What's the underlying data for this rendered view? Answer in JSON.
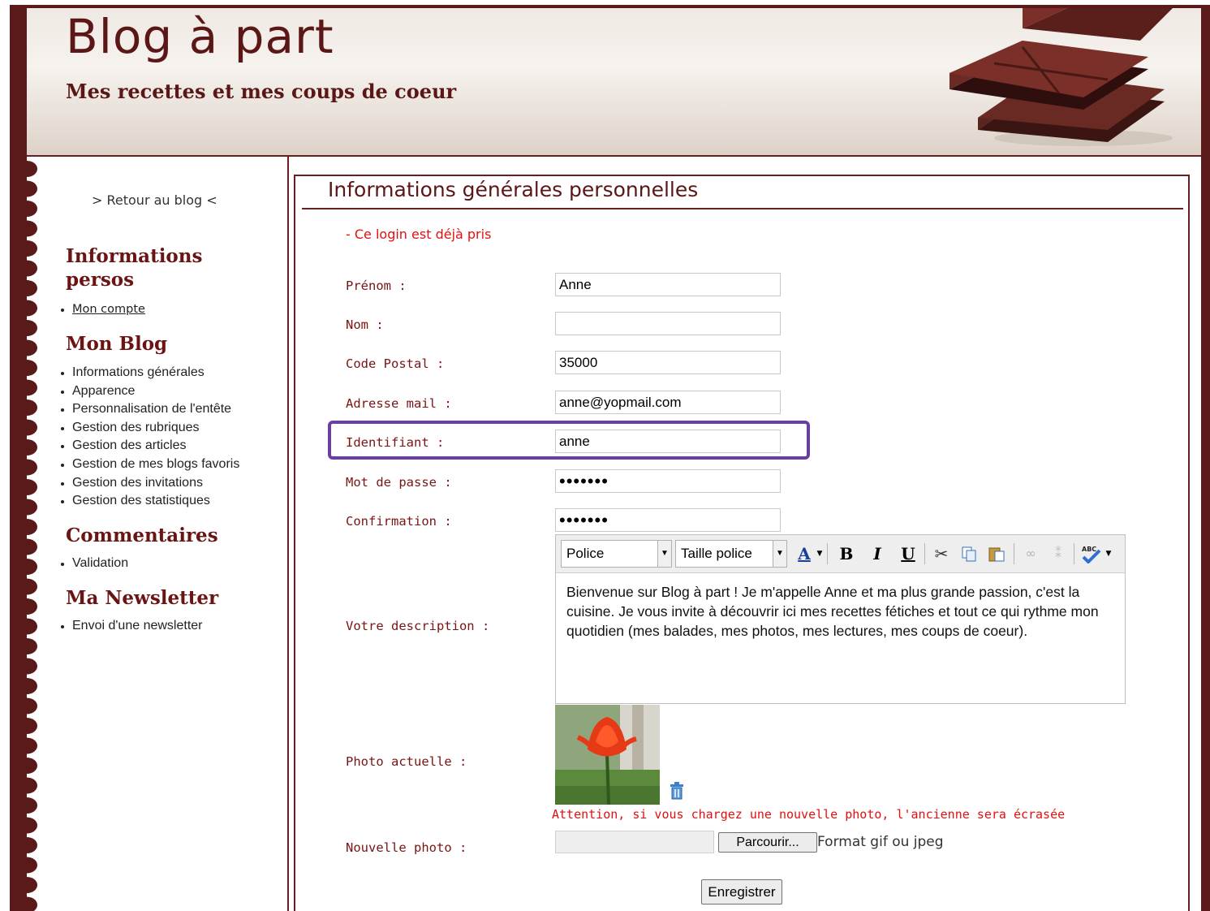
{
  "header": {
    "title": "Blog à part",
    "tagline": "Mes recettes et mes coups de coeur"
  },
  "sidebar": {
    "back_link": "> Retour au blog <",
    "sections": [
      {
        "heading_line1": "Informations",
        "heading_line2": "persos",
        "items": [
          "Mon compte"
        ]
      },
      {
        "heading": "Mon Blog",
        "items": [
          "Informations générales",
          "Apparence",
          "Personnalisation de l'entête",
          "Gestion des rubriques",
          "Gestion des articles",
          "Gestion de mes blogs favoris",
          "Gestion des invitations",
          "Gestion des statistiques"
        ]
      },
      {
        "heading": "Commentaires",
        "items": [
          "Validation"
        ]
      },
      {
        "heading": "Ma Newsletter",
        "items": [
          "Envoi d'une newsletter"
        ]
      }
    ]
  },
  "main": {
    "title": "Informations générales personnelles",
    "error": "- Ce login est déjà pris",
    "fields": {
      "prenom": {
        "label": "Prénom :",
        "value": "Anne"
      },
      "nom": {
        "label": "Nom :",
        "value": ""
      },
      "code_postal": {
        "label": "Code Postal :",
        "value": "35000"
      },
      "email": {
        "label": "Adresse mail :",
        "value": "anne@yopmail.com"
      },
      "identifiant": {
        "label": "Identifiant :",
        "value": "anne"
      },
      "mot_de_passe": {
        "label": "Mot de passe :",
        "value": "annepwd"
      },
      "confirmation": {
        "label": "Confirmation :",
        "value": "annepwd"
      }
    },
    "description": {
      "label": "Votre description :",
      "toolbar": {
        "font": "Police",
        "font_size": "Taille police"
      },
      "text": "Bienvenue sur Blog à part ! Je m'appelle Anne et ma plus grande passion, c'est la cuisine. Je vous invite à découvrir ici mes recettes fétiches et tout ce qui rythme mon quotidien (mes balades, mes photos, mes lectures, mes coups de coeur)."
    },
    "photo": {
      "label": "Photo actuelle :",
      "warning": "Attention, si vous chargez une nouvelle photo, l'ancienne sera écrasée"
    },
    "new_photo": {
      "label": "Nouvelle photo :",
      "browse_label": "Parcourir...",
      "format_hint": "Format gif ou jpeg"
    },
    "save_label": "Enregistrer"
  },
  "colors": {
    "brand": "#5b1616",
    "label": "#7a1414",
    "error": "#e01010",
    "highlight": "#6b3fa0"
  }
}
